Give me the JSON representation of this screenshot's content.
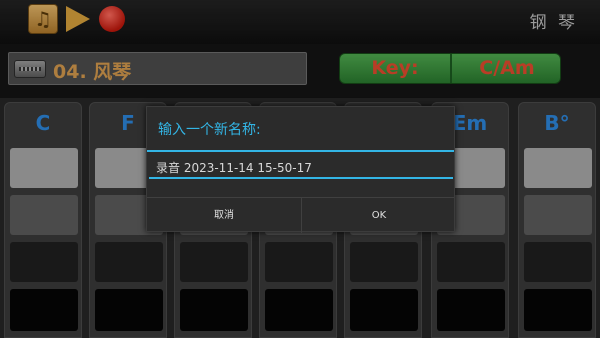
{
  "topbar": {
    "app_title": "钢 琴",
    "icons": [
      "music-note-icon",
      "play-icon",
      "record-icon"
    ],
    "music_glyph": "♫"
  },
  "instrument": {
    "name": "04. 风琴",
    "icon": "accordion-icon"
  },
  "key": {
    "label": "Key:",
    "value": "C/Am"
  },
  "chords": [
    {
      "label": "C"
    },
    {
      "label": "F"
    },
    {
      "label": ""
    },
    {
      "label": ""
    },
    {
      "label": ""
    },
    {
      "label": "Em"
    },
    {
      "label": "B°"
    }
  ],
  "dialog": {
    "title": "输入一个新名称:",
    "input_value": "录音 2023-11-14 15-50-17",
    "cancel_label": "取消",
    "ok_label": "OK"
  },
  "colors": {
    "accent": "#33b5e5",
    "chord_label": "#2d87dc",
    "key_text": "#e24b2f",
    "key_bg": "#3f8f43",
    "instrument_text": "#d59a4d"
  }
}
